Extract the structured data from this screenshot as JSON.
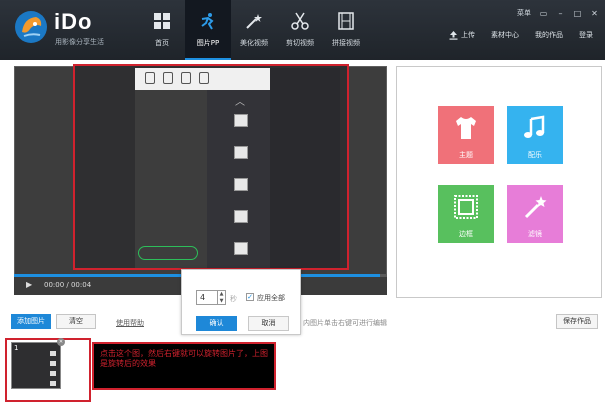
{
  "app": {
    "brand": "iDo",
    "slogan": "用影像分享生活"
  },
  "nav": [
    {
      "label": "首页",
      "icon": "grid-icon",
      "active": false
    },
    {
      "label": "图片PP",
      "icon": "figure-icon",
      "active": true
    },
    {
      "label": "美化视频",
      "icon": "magic-wand-icon",
      "active": false
    },
    {
      "label": "剪切视频",
      "icon": "scissors-icon",
      "active": false
    },
    {
      "label": "拼接视频",
      "icon": "film-icon",
      "active": false
    }
  ],
  "window_controls": {
    "menu_label": "菜单"
  },
  "right_nav": {
    "upload": "上传",
    "material_center": "素材中心",
    "my_works": "我的作品",
    "login": "登录"
  },
  "player": {
    "time": "00:00 / 00:04",
    "progress": 0.98
  },
  "rotate_dialog": {
    "value": "4",
    "unit": "秒",
    "apply_all_label": "应用全部",
    "apply_all_checked": true,
    "confirm_label": "确认",
    "cancel_label": "取消"
  },
  "tiles": [
    {
      "label": "主题",
      "icon": "shirt-icon",
      "color": "#f07179"
    },
    {
      "label": "配乐",
      "icon": "music-note-icon",
      "color": "#35b3ef"
    },
    {
      "label": "边框",
      "icon": "frame-icon",
      "color": "#58c05e"
    },
    {
      "label": "滤镜",
      "icon": "magic-wand-icon",
      "color": "#e77dd8"
    }
  ],
  "toolbar": {
    "add_label": "添加图片",
    "clear_label": "清空",
    "help_label": "使用帮助",
    "hint": "内图片单击右键可进行编辑",
    "save_label": "保存作品"
  },
  "filmstrip": {
    "thumb_number": "1",
    "note": "点击这个图，然后右键就可以旋转图片了，上图是旋转后的效果"
  },
  "colors": {
    "accent": "#1e88d8",
    "highlight": "#d0222e",
    "topbar": "#262b31"
  }
}
